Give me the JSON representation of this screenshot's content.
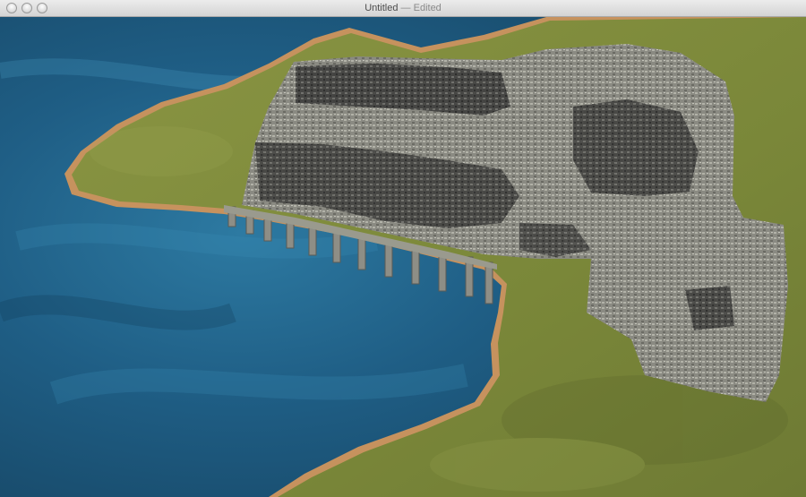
{
  "window": {
    "title": "Untitled",
    "separator": "—",
    "status": "Edited",
    "buttons": [
      "close",
      "minimize",
      "zoom"
    ]
  },
  "scene": {
    "description_icon": "3d-terrain-city-view",
    "colors": {
      "water_deep": "#1e4f6e",
      "water_light": "#2f7fa6",
      "land": "#7d8a3c",
      "beach": "#c79a62",
      "city_light": "#8d8d84",
      "city_dark": "#3a3a3a"
    }
  }
}
